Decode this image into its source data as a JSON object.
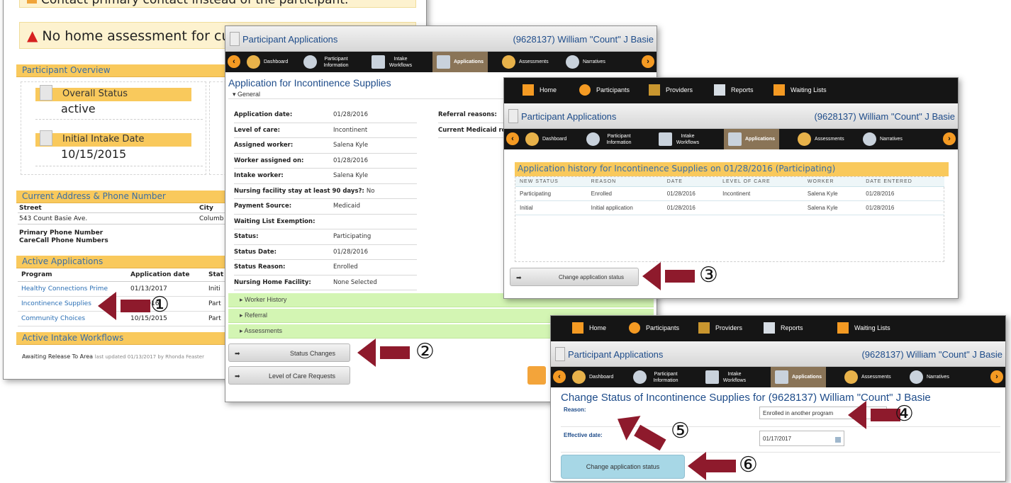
{
  "panel1": {
    "alert_top": "Contact primary contact instead of the participant.",
    "alert_home": "No home assessment for cu",
    "overview_title": "Participant Overview",
    "overall_status_label": "Overall Status",
    "overall_status_value": "active",
    "intake_label": "Initial Intake Date",
    "intake_value": "10/15/2015",
    "address_title": "Current Address & Phone Number",
    "address_headers": [
      "Street",
      "City"
    ],
    "street": "543 Count Basie Ave.",
    "city": "Columb",
    "primary_phone": "Primary Phone Number",
    "carecall_phone": "CareCall Phone Numbers",
    "apps_title": "Active Applications",
    "apps_headers": [
      "Program",
      "Application date",
      "Stat"
    ],
    "apps_rows": [
      {
        "program": "Healthy Connections Prime",
        "date": "01/13/2017",
        "status": "Initi"
      },
      {
        "program": "Incontinence Supplies",
        "date": "/28/2016",
        "status": "Part"
      },
      {
        "program": "Community Choices",
        "date": "10/15/2015",
        "status": "Part"
      }
    ],
    "workflows_title": "Active Intake Workflows",
    "workflow_text": "Awaiting Release To Area",
    "workflow_meta": "last updated 01/13/2017 by Rhonda Feaster"
  },
  "panel2": {
    "title": "Participant Applications",
    "who": "(9628137) William \"Count\" J Basie",
    "nav": [
      {
        "label": "Dashboard"
      },
      {
        "label": "Participant Information"
      },
      {
        "label": "Intake Workflows"
      },
      {
        "label": "Applications"
      },
      {
        "label": "Assessments"
      },
      {
        "label": "Narratives"
      }
    ],
    "form_title": "Application for Incontinence Supplies",
    "general_label": "General",
    "fields": [
      {
        "k": "Application date:",
        "v": "01/28/2016"
      },
      {
        "k": "Level of care:",
        "v": "Incontinent"
      },
      {
        "k": "Assigned worker:",
        "v": "Salena Kyle"
      },
      {
        "k": "Worker assigned on:",
        "v": "01/28/2016"
      },
      {
        "k": "Intake worker:",
        "v": "Salena Kyle"
      },
      {
        "k": "Nursing facility stay at least 90 days?:",
        "v": "No"
      },
      {
        "k": "Payment Source:",
        "v": "Medicaid"
      },
      {
        "k": "Waiting List Exemption:",
        "v": ""
      },
      {
        "k": "Status:",
        "v": "Participating"
      },
      {
        "k": "Status Date:",
        "v": "01/28/2016"
      },
      {
        "k": "Status Reason:",
        "v": "Enrolled"
      },
      {
        "k": "Nursing Home Facility:",
        "v": "None Selected"
      }
    ],
    "referral_reasons": "Referral reasons:",
    "current_medicaid": "Current Medicaid re",
    "accordions": [
      "Worker History",
      "Referral",
      "Assessments"
    ],
    "btn_status_changes": "Status Changes",
    "btn_loc_requests": "Level of Care Requests"
  },
  "topnav": [
    "Home",
    "Participants",
    "Providers",
    "Reports",
    "Waiting Lists"
  ],
  "panel3": {
    "title": "Participant Applications",
    "who": "(9628137) William \"Count\" J Basie",
    "history_title": "Application history for Incontinence Supplies on 01/28/2016 (Participating)",
    "headers": [
      "NEW STATUS",
      "REASON",
      "DATE",
      "LEVEL OF CARE",
      "WORKER",
      "DATE ENTERED"
    ],
    "rows": [
      [
        "Participating",
        "Enrolled",
        "01/28/2016",
        "Incontinent",
        "Salena Kyle",
        "01/28/2016"
      ],
      [
        "Initial",
        "Initial application",
        "01/28/2016",
        "",
        "Salena Kyle",
        "01/28/2016"
      ]
    ],
    "btn_change": "Change application status"
  },
  "panel4": {
    "title": "Participant Applications",
    "who": "(9628137) William \"Count\" J Basie",
    "form_title": "Change Status of Incontinence Supplies for (9628137) William \"Count\" J Basie",
    "reason_label": "Reason:",
    "reason_value": "Enrolled in another program",
    "effective_label": "Effective date:",
    "effective_value": "01/17/2017",
    "btn_change": "Change application status"
  },
  "callouts": [
    "①",
    "②",
    "③",
    "④",
    "⑤",
    "⑥"
  ],
  "colors": {
    "callout": "#8e1a2c",
    "section": "#f9c95c",
    "accordion": "#d3f5b3",
    "nav": "#161616",
    "link": "#2a6fb5"
  }
}
